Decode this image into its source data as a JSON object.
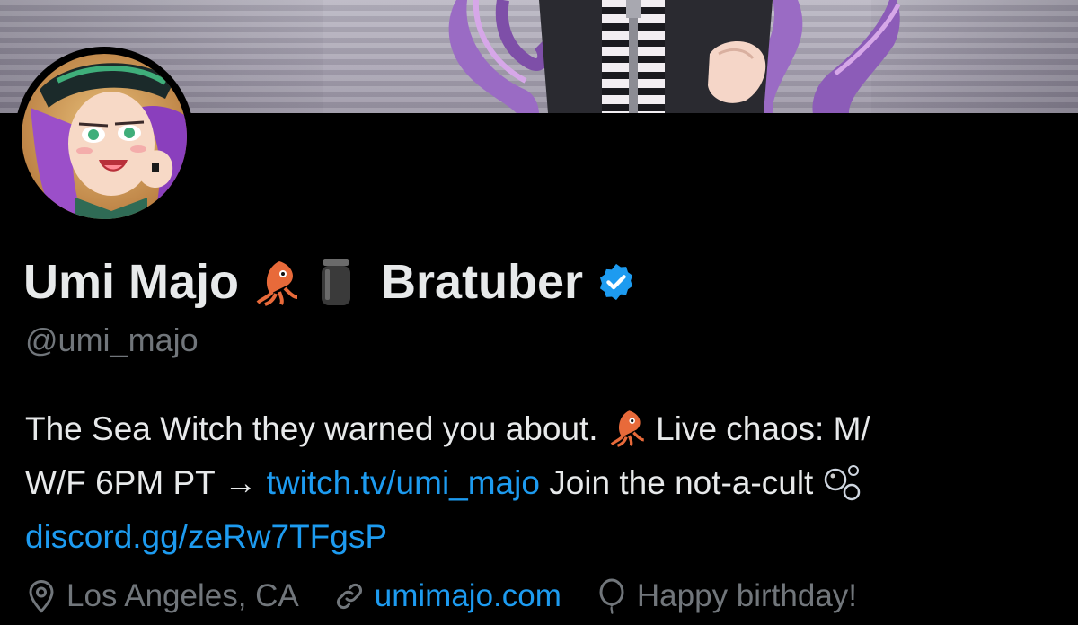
{
  "profile": {
    "display_name_part1": "Umi Majo",
    "display_name_part2": "Bratuber",
    "emojis": [
      "squid-emoji",
      "jar-emoji"
    ],
    "verified": true,
    "handle": "@umi_majo"
  },
  "bio": {
    "line1_text": "The Sea Witch they warned you about.",
    "line1_after_emoji": " Live chaos: M/",
    "line2_prefix": "W/F 6PM PT → ",
    "line2_link": "twitch.tv/umi_majo",
    "line2_suffix": " Join the not-a-cult ",
    "line3_link": "discord.gg/zeRw7TFgsP"
  },
  "meta": {
    "location": "Los Angeles, CA",
    "website": "umimajo.com",
    "birthday": "Happy birthday!"
  },
  "colors": {
    "background": "#000000",
    "text": "#e7e9ea",
    "secondary": "#71767b",
    "link": "#1d9bf0",
    "verified": "#1d9bf0"
  },
  "icons": [
    "location-icon",
    "link-icon",
    "balloon-icon",
    "verified-badge-icon",
    "bubbles-emoji"
  ]
}
